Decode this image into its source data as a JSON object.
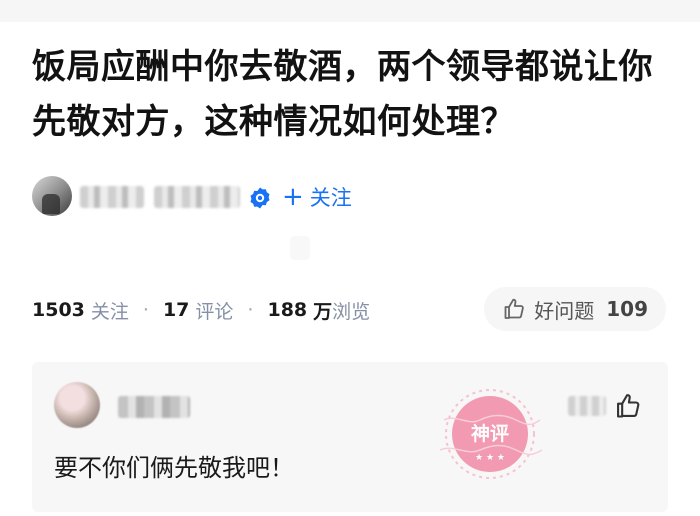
{
  "question": {
    "title": "饭局应酬中你去敬酒，两个领导都说让你先敬对方，这种情况如何处理？"
  },
  "author": {
    "follow_label": "关注",
    "follow_icon": "plus-icon"
  },
  "stats": {
    "followers_count": "1503",
    "followers_label": "关注",
    "comments_count": "17",
    "comments_label": "评论",
    "views_count": "188",
    "views_unit": "万",
    "views_label": "浏览",
    "separator": "·"
  },
  "helpful": {
    "label": "好问题",
    "count": "109",
    "icon": "thumb-up-icon"
  },
  "comment": {
    "text": "要不你们俩先敬我吧！",
    "stamp_text": "神评",
    "like_icon": "thumb-up-icon"
  },
  "colors": {
    "accent": "#1772f6",
    "stamp": "#f28aa6",
    "card_bg": "#f7f7f7",
    "muted": "#8590a6"
  }
}
